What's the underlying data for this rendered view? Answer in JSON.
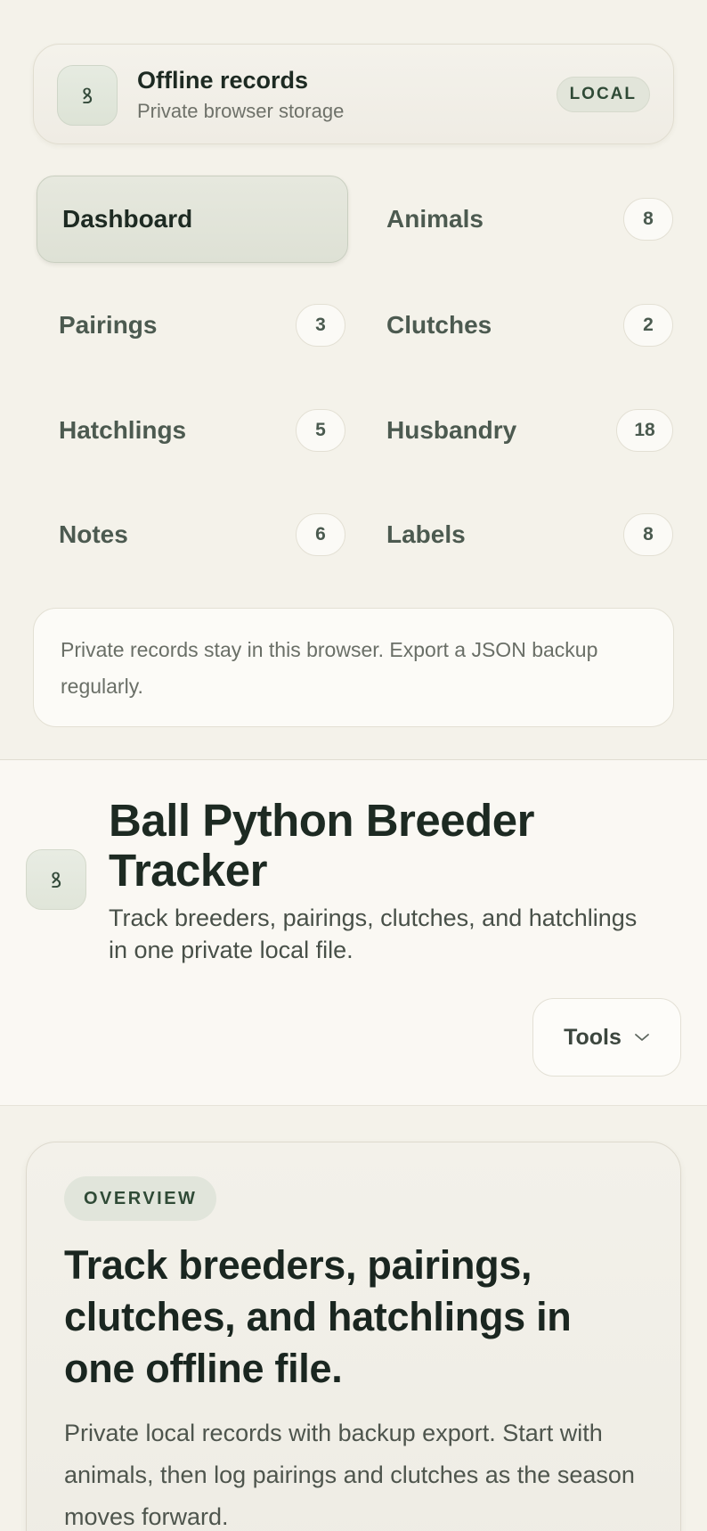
{
  "brand": {
    "icon": "snake-icon",
    "title": "Offline records",
    "subtitle": "Private browser storage",
    "badge": "LOCAL"
  },
  "nav": {
    "dashboard": {
      "label": "Dashboard",
      "active": true
    },
    "animals": {
      "label": "Animals",
      "count": "8"
    },
    "pairings": {
      "label": "Pairings",
      "count": "3"
    },
    "clutches": {
      "label": "Clutches",
      "count": "2"
    },
    "hatchlings": {
      "label": "Hatchlings",
      "count": "5"
    },
    "husbandry": {
      "label": "Husbandry",
      "count": "18"
    },
    "notes": {
      "label": "Notes",
      "count": "6"
    },
    "labels": {
      "label": "Labels",
      "count": "8"
    }
  },
  "notice": {
    "text": "Private records stay in this browser. Export a JSON backup regularly."
  },
  "header": {
    "icon": "snake-icon",
    "title": "Ball Python Breeder Tracker",
    "subtitle": "Track breeders, pairings, clutches, and hatchlings in one private local file.",
    "tools_label": "Tools",
    "tools_icon": "chevron-down-icon"
  },
  "overview": {
    "tag": "OVERVIEW",
    "title": "Track breeders, pairings, clutches, and hatchlings in one offline file.",
    "text": "Private local records with backup export. Start with animals, then log pairings and clutches as the season moves forward."
  },
  "colors": {
    "background": "#f4f2ea",
    "text": "#1d2a22",
    "accent": "#2f4a36",
    "active_nav": "#e2e5da"
  }
}
